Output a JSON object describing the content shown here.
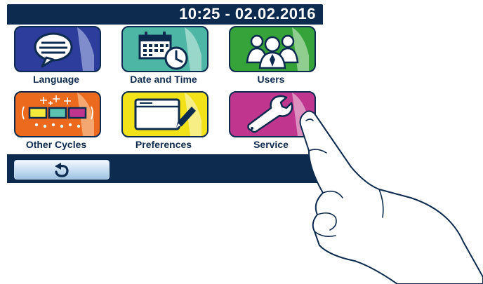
{
  "header": {
    "clock": "10:25 - 02.02.2016"
  },
  "menu": {
    "items": [
      {
        "label": "Language",
        "icon": "speech-bubble-icon",
        "color": "#2d3d9b"
      },
      {
        "label": "Date and Time",
        "icon": "calendar-clock-icon",
        "color": "#4db6a4"
      },
      {
        "label": "Users",
        "icon": "users-icon",
        "color": "#35a33a"
      },
      {
        "label": "Other Cycles",
        "icon": "cycles-icon",
        "color": "#ec6a1e"
      },
      {
        "label": "Preferences",
        "icon": "preferences-icon",
        "color": "#f2e21a"
      },
      {
        "label": "Service",
        "icon": "wrench-icon",
        "color": "#c0368f"
      }
    ]
  },
  "footer": {
    "back_icon": "undo-arrow-icon"
  },
  "colors": {
    "frame": "#0d2a4f",
    "label": "#0d2a4f"
  }
}
